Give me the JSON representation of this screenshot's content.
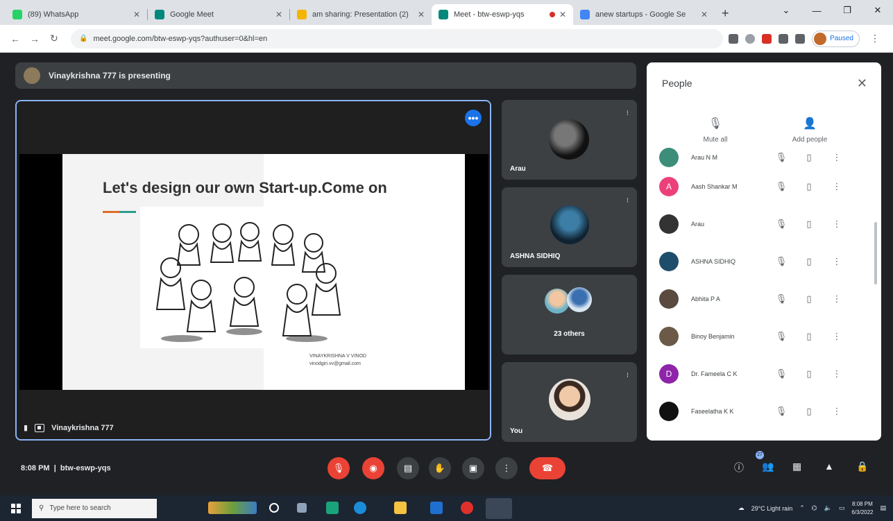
{
  "browser": {
    "tabs": [
      {
        "title": "(89) WhatsApp",
        "favicon_color": "#25d366",
        "active": false
      },
      {
        "title": "Google Meet",
        "favicon_color": "#00897b",
        "active": false
      },
      {
        "title": "am sharing: Presentation (2)",
        "favicon_color": "#f4b400",
        "active": false
      },
      {
        "title": "Meet - btw-eswp-yqs",
        "favicon_color": "#00897b",
        "active": true
      },
      {
        "title": "anew startups - Google Se",
        "favicon_color": "#4285f4",
        "active": false
      }
    ],
    "new_tab_symbol": "+",
    "address": "meet.google.com/btw-eswp-yqs?authuser=0&hl=en",
    "profile_label": "Paused"
  },
  "meet": {
    "presenting_text": "Vinaykrishna 777 is presenting",
    "presenter_label": "Vinaykrishna 777",
    "slide": {
      "title": "Let's design our own Start-up.Come on",
      "credit_name": "VINAYKRISHNA V VINOD",
      "credit_email": "vinodgiri.vv@gmail.com"
    },
    "tiles": [
      {
        "name": "Arau"
      },
      {
        "name": "ASHNA SIDHIQ"
      },
      {
        "name": "23 others"
      },
      {
        "name": "You"
      }
    ],
    "meeting_time": "8:08 PM",
    "meeting_code": "btw-eswp-yqs",
    "participant_count": "27"
  },
  "people": {
    "title": "People",
    "mute_all": "Mute all",
    "add_people": "Add people",
    "list": [
      {
        "name": "Arau N M",
        "initial": "",
        "color": "#3c8d7a"
      },
      {
        "name": "Aash Shankar M",
        "initial": "A",
        "color": "#ec407a"
      },
      {
        "name": "Arau",
        "initial": "",
        "color": "#333333"
      },
      {
        "name": "ASHNA SIDHIQ",
        "initial": "",
        "color": "#1e4d6b"
      },
      {
        "name": "Abhita P A",
        "initial": "",
        "color": "#5a4a3f"
      },
      {
        "name": "Binoy Benjamin",
        "initial": "",
        "color": "#6b5a48"
      },
      {
        "name": "Dr. Fameela C K",
        "initial": "D",
        "color": "#8e24aa"
      },
      {
        "name": "Faseelatha K K",
        "initial": "",
        "color": "#111111"
      }
    ]
  },
  "taskbar": {
    "search_placeholder": "Type here to search",
    "weather": "29°C Light rain",
    "time": "8:08 PM",
    "date": "6/3/2022"
  }
}
